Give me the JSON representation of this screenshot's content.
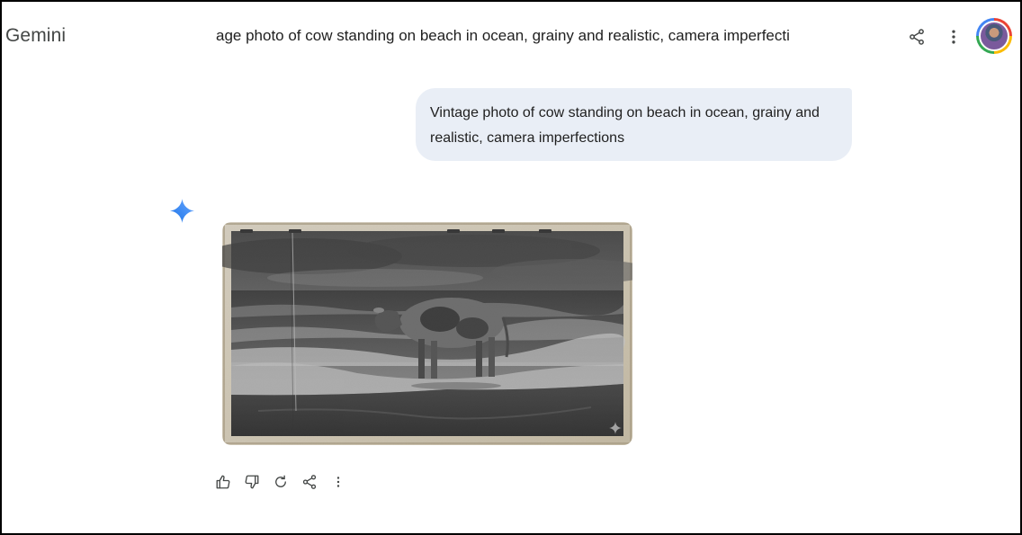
{
  "app": {
    "brand": "Gemini",
    "conversation_title": "age photo of cow standing on beach in ocean, grainy and realistic, camera imperfecti"
  },
  "header": {
    "icons": [
      "share-icon",
      "more-vert-icon"
    ],
    "avatar": "user-avatar"
  },
  "chat": {
    "user_prompt": "Vintage photo of cow standing on beach in ocean, grainy and realistic, camera imperfections",
    "response": {
      "icon": "gemini-sparkle-icon",
      "image": "generated-image",
      "actions": [
        "thumb-up-icon",
        "thumb-down-icon",
        "regenerate-icon",
        "share-icon",
        "more-vert-icon"
      ]
    }
  },
  "colors": {
    "bubble_bg": "#e9eef6",
    "brand_text": "#444746",
    "sparkle_blue": "#4285f4",
    "icon_gray": "#444746"
  }
}
